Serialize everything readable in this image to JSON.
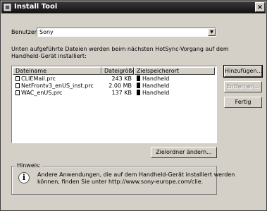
{
  "window": {
    "title": "Install Tool",
    "close_glyph": "×"
  },
  "user": {
    "label": "Benutzer:",
    "value": "Sony"
  },
  "instructions": {
    "line1": "Unten aufgeführte Dateien werden beim nächsten HotSync-Vorgang auf dem",
    "line2": "Handheld-Gerät installiert:"
  },
  "table": {
    "columns": [
      "Dateiname",
      "Dateigröße",
      "Zielspeicherort"
    ],
    "rows": [
      {
        "name": "CLIEMail.prc",
        "size": "243 KB",
        "dest": "Handheld"
      },
      {
        "name": "NetFrontv3_enUS_inst.prc",
        "size": "2.00 MB",
        "dest": "Handheld"
      },
      {
        "name": "WAC_enUS.prc",
        "size": "137 KB",
        "dest": "Handheld"
      }
    ]
  },
  "buttons": {
    "add": "Hinzufügen...",
    "remove": "Entfernen...",
    "done": "Fertig",
    "change_folder": "Zielordner ändern..."
  },
  "hint": {
    "legend": "Hinweis:",
    "line1": "Andere Anwendungen, die auf dem Handheld-Gerät installiert werden",
    "line2": "können, finden Sie unter http://www.sony-europe.com/clie."
  },
  "icons": {
    "app": "install-tool-icon",
    "info": "info-icon",
    "file": "file-icon",
    "handheld": "handheld-icon"
  }
}
